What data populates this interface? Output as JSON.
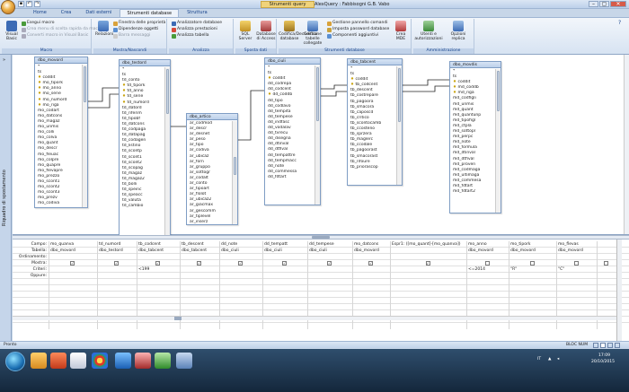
{
  "window": {
    "context_tab": "Strumenti query",
    "title": "AlexQuery : Fabbisogni G.B. Vabo",
    "min": "–",
    "max": "▢",
    "close": "✕"
  },
  "tabs": [
    "Home",
    "Crea",
    "Dati esterni",
    "Strumenti database",
    "Struttura"
  ],
  "ribbon": {
    "groups": [
      {
        "label": "Macro",
        "items": {
          "big": "Visual Basic",
          "small": [
            "Esegui macro",
            "Crea menu di scelta rapida da macro",
            "Converti macro in Visual Basic"
          ]
        }
      },
      {
        "label": "Mostra/Nascondi",
        "items": {
          "big": "Relazioni",
          "small": [
            "Finestra delle proprietà",
            "Dipendenze oggetti",
            "Barra messaggi"
          ]
        }
      },
      {
        "label": "Analizza",
        "items": {
          "small": [
            "Analizzatore database",
            "Analizza prestazioni",
            "Analizza tabella"
          ]
        }
      },
      {
        "label": "Sposta dati",
        "items": {
          "big": [
            "SQL Server",
            "Database di Access"
          ]
        }
      },
      {
        "label": "Strumenti database",
        "items": {
          "big": [
            "Codifica/Decodifica database",
            "Gestione tabelle collegate",
            "Crea MDE"
          ],
          "small": [
            "Gestione pannello comandi",
            "Imposta password database",
            "Componenti aggiuntivi"
          ]
        }
      },
      {
        "label": "Amministrazione",
        "items": {
          "big": [
            "Utenti e autorizzazioni",
            "Opzioni replica"
          ]
        }
      }
    ]
  },
  "sidebar": {
    "label": "Riquadro di spostamento",
    "toggle": "»"
  },
  "tables": [
    {
      "name": "dbo_movord",
      "fields": [
        "*",
        "ts",
        "coddit",
        "mo_tipork",
        "mo_anno",
        "mo_serie",
        "mo_numord",
        "mo_riga",
        "mo_codart",
        "mo_datcons",
        "mo_magaz",
        "mo_unmis",
        "mo_colli",
        "mo_colva",
        "mo_quant",
        "mo_descr",
        "mo_fleuac",
        "mo_colpre",
        "mo_quapre",
        "mo_flevapre",
        "mo_prezzo",
        "mo_scont1",
        "mo_scont2",
        "mo_scont3",
        "mo_prezv",
        "mo_codiva"
      ],
      "keys": [
        2,
        3,
        4,
        5,
        6,
        7
      ]
    },
    {
      "name": "dbo_testord",
      "fields": [
        "*",
        "ts",
        "td_conto",
        "td_tipork",
        "td_anno",
        "td_serie",
        "td_numord",
        "td_datord",
        "td_riferim",
        "td_tipobf",
        "td_datcons",
        "td_codpaga",
        "td_datapag",
        "td_codagen",
        "td_listino",
        "td_scontp",
        "td_scont1",
        "td_scont2",
        "td_scopag",
        "td_magaz",
        "td_magaz2",
        "td_bolli",
        "td_speinc",
        "td_speacc",
        "td_valuta",
        "td_cambio"
      ],
      "keys": [
        3,
        4,
        5,
        6
      ]
    },
    {
      "name": "dbo_artico",
      "fields": [
        "ar_codmod",
        "ar_descr",
        "ar_desnet",
        "ar_peso",
        "ar_tipo",
        "ar_codiva",
        "ar_ubicaz",
        "ar_forn",
        "ar_gruppo",
        "ar_sottogr",
        "ar_codalt",
        "ar_conto",
        "ar_tipoart",
        "ar_flolot",
        "ar_ubicaz2",
        "ar_giacmax",
        "ar_gescomm",
        "ar_tiplevel",
        "ar_inserz"
      ],
      "keys": []
    },
    {
      "name": "dbo_ciuli",
      "fields": [
        "*",
        "ts",
        "coddit",
        "dd_codrepa",
        "dd_codcent",
        "dd_coddb",
        "dd_tipo",
        "dd_codlavo",
        "dd_tempita",
        "dd_tempese",
        "dd_indfasc",
        "dd_vodalav",
        "dd_tvrecu",
        "dd_disegna",
        "dd_dtinval",
        "dd_dtfival",
        "dd_tempattre",
        "dd_tempmacc",
        "dd_note",
        "dd_commessa",
        "dd_fdtart"
      ],
      "keys": [
        2,
        5
      ]
    },
    {
      "name": "dbo_tabcent",
      "fields": [
        "*",
        "ts",
        "coddit",
        "tb_codcent",
        "tb_descent",
        "tb_costrepare",
        "tb_pagoora",
        "tb_smacora",
        "tb_caposcd",
        "tb_critico",
        "tb_scontocamb",
        "tb_ccosteno",
        "tb_sprzera",
        "tb_maglerc",
        "tb_ccodale",
        "tb_pagoorast",
        "tb_smacorast",
        "tb_rifoure",
        "tb_priorascop"
      ],
      "keys": [
        2,
        3
      ]
    },
    {
      "name": "dbo_movdis",
      "fields": [
        "*",
        "ts",
        "coddit",
        "md_coddb",
        "md_riga",
        "md_codfigli",
        "md_unmis",
        "md_quant",
        "md_quantunp",
        "md_tipofigl",
        "md_ctpla",
        "md_sottopl",
        "md_perpc",
        "md_note",
        "md_formula",
        "md_dtinval",
        "md_dtfival",
        "md_proven",
        "md_codmaga",
        "md_ultimaga",
        "md_commesa",
        "md_fdtart",
        "md_fdtart2"
      ],
      "keys": [
        2,
        3,
        4
      ]
    }
  ],
  "grid": {
    "row_labels": [
      "Campo:",
      "Tabella:",
      "Ordinamento:",
      "Mostra:",
      "Criteri:",
      "Oppure:"
    ],
    "columns": [
      {
        "campo": "mo_quanva",
        "tabella": "dbo_movord",
        "criteri": "",
        "mostra": true
      },
      {
        "campo": "td_numord",
        "tabella": "dbo_testord",
        "criteri": "",
        "mostra": true
      },
      {
        "campo": "tb_codcent",
        "tabella": "dbo_tabcent",
        "criteri": "<199",
        "mostra": true
      },
      {
        "campo": "tb_descent",
        "tabella": "dbo_tabcent",
        "criteri": "",
        "mostra": true
      },
      {
        "campo": "dd_note",
        "tabella": "dbo_ciuli",
        "criteri": "",
        "mostra": true
      },
      {
        "campo": "dd_tempatt",
        "tabella": "dbo_ciuli",
        "criteri": "",
        "mostra": true
      },
      {
        "campo": "dd_tempese",
        "tabella": "dbo_ciuli",
        "criteri": "",
        "mostra": true
      },
      {
        "campo": "mo_datcons",
        "tabella": "dbo_movord",
        "criteri": "",
        "mostra": true
      },
      {
        "campo": "Espr1: ([mo_quant]-[mo_quanva])",
        "tabella": "",
        "criteri": "",
        "mostra": true
      },
      {
        "campo": "mo_anno",
        "tabella": "dbo_movord",
        "criteri": "<=2014",
        "mostra": false
      },
      {
        "campo": "mo_tipork",
        "tabella": "dbo_movord",
        "criteri": "\"R\"",
        "mostra": false
      },
      {
        "campo": "mo_flevas",
        "tabella": "dbo_movord",
        "criteri": "\"C\"",
        "mostra": false
      },
      {
        "campo": "",
        "tabella": "",
        "criteri": "",
        "mostra": false
      }
    ]
  },
  "status": {
    "left": "Pronto",
    "right": "BLOC NUM"
  },
  "tray": {
    "lang": "IT",
    "time": "17:09",
    "date": "20/10/2015"
  }
}
